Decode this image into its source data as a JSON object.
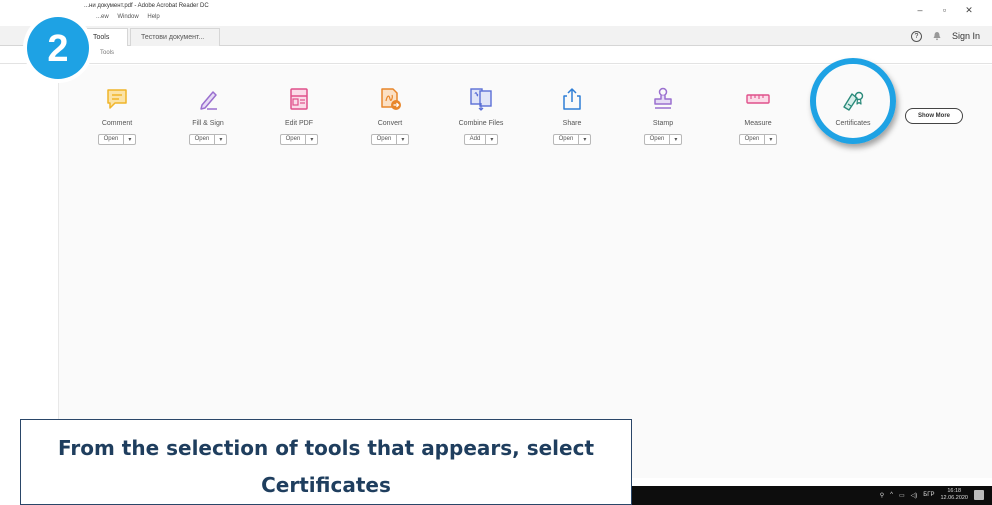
{
  "window": {
    "title": "...ни документ.pdf - Adobe Acrobat Reader DC",
    "menu": [
      "...ew",
      "Window",
      "Help"
    ],
    "controls": [
      "–",
      "▫",
      "✕"
    ]
  },
  "tabs": [
    {
      "label": "Tools"
    },
    {
      "label": "Тестови документ..."
    }
  ],
  "header_right": {
    "help": "?",
    "sign_in": "Sign In"
  },
  "breadcrumb": "Tools",
  "tools": [
    {
      "label": "Comment",
      "button": "Open",
      "icon": "comment-icon",
      "color": "#f0b429"
    },
    {
      "label": "Fill & Sign",
      "button": "Open",
      "icon": "fill-sign-icon",
      "color": "#9a6fcf"
    },
    {
      "label": "Edit PDF",
      "button": "Open",
      "icon": "edit-pdf-icon",
      "color": "#e0508a"
    },
    {
      "label": "Convert",
      "button": "Open",
      "icon": "convert-icon",
      "color": "#e8862a"
    },
    {
      "label": "Combine Files",
      "button": "Add",
      "icon": "combine-files-icon",
      "color": "#5b6fd6"
    },
    {
      "label": "Share",
      "button": "Open",
      "icon": "share-icon",
      "color": "#2e7ed6"
    },
    {
      "label": "Stamp",
      "button": "Open",
      "icon": "stamp-icon",
      "color": "#9a6fcf"
    },
    {
      "label": "Measure",
      "button": "Open",
      "icon": "measure-icon",
      "color": "#e0508a"
    },
    {
      "label": "Certificates",
      "button": "",
      "icon": "certificates-icon",
      "color": "#2a8a7a"
    }
  ],
  "dropdown_glyph": "▾",
  "show_more": "Show More",
  "step": {
    "number": "2",
    "color": "#1ea2e4"
  },
  "caption": "From the selection of tools that appears, select Certificates",
  "taskbar": {
    "lang": "БГР",
    "time": "16:18",
    "date": "12.06.2020"
  }
}
